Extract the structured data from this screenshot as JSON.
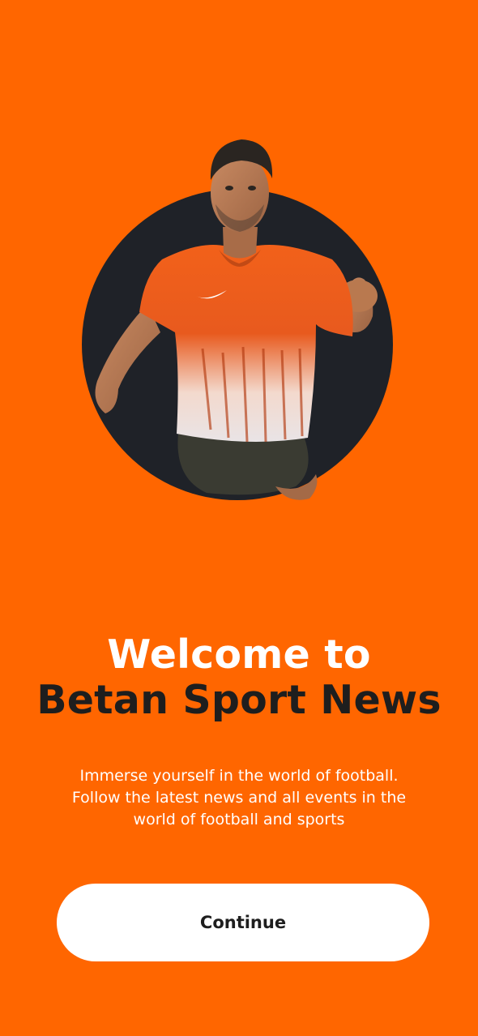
{
  "colors": {
    "background": "#FF6600",
    "circle": "#1F2228",
    "title_primary": "#FFFFFF",
    "title_secondary": "#1E1E1E",
    "button_bg": "#FFFFFF",
    "button_text": "#1E1E1E"
  },
  "hero": {
    "image": "football-player-illustration"
  },
  "title": {
    "line1": "Welcome to",
    "line2": "Betan Sport News"
  },
  "subtitle": {
    "lines": [
      "Immerse yourself in the world of football.",
      "Follow the latest news and all events in the",
      "world of football and sports"
    ]
  },
  "continue_button": {
    "label": "Continue"
  }
}
